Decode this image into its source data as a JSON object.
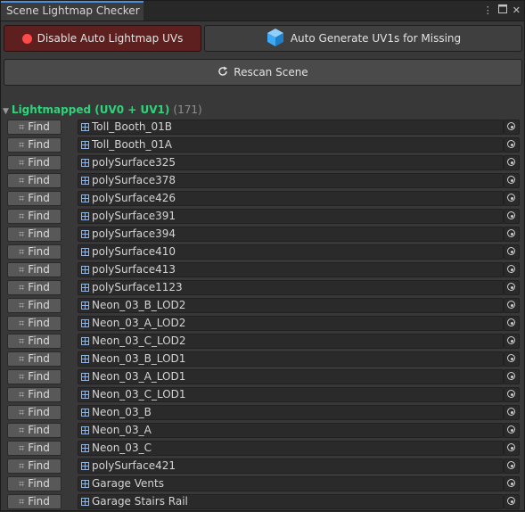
{
  "window": {
    "tab_title": "Scene Lightmap Checker",
    "menu_icon": "kebab-icon",
    "maximize_icon": "maximize-icon",
    "close_icon": "close-icon"
  },
  "toolbar": {
    "disable_label": "Disable Auto Lightmap UVs",
    "auto_generate_label": "Auto Generate UV1s for Missing",
    "rescan_label": "Rescan Scene"
  },
  "colors": {
    "accent_tab": "#4a8fe0",
    "section_title": "#2ed47a",
    "disable_bg": "#5e1f1f",
    "status_dot": "#ff4a4a",
    "cube_icon": "#3fa9f5"
  },
  "section": {
    "title": "Lightmapped (UV0 + UV1)",
    "count": "(171)"
  },
  "find_label": "Find",
  "items": [
    "Toll_Booth_01B",
    "Toll_Booth_01A",
    "polySurface325",
    "polySurface378",
    "polySurface426",
    "polySurface391",
    "polySurface394",
    "polySurface410",
    "polySurface413",
    "polySurface1123",
    "Neon_03_B_LOD2",
    "Neon_03_A_LOD2",
    "Neon_03_C_LOD2",
    "Neon_03_B_LOD1",
    "Neon_03_A_LOD1",
    "Neon_03_C_LOD1",
    "Neon_03_B",
    "Neon_03_A",
    "Neon_03_C",
    "polySurface421",
    "Garage Vents",
    "Garage Stairs Rail"
  ]
}
